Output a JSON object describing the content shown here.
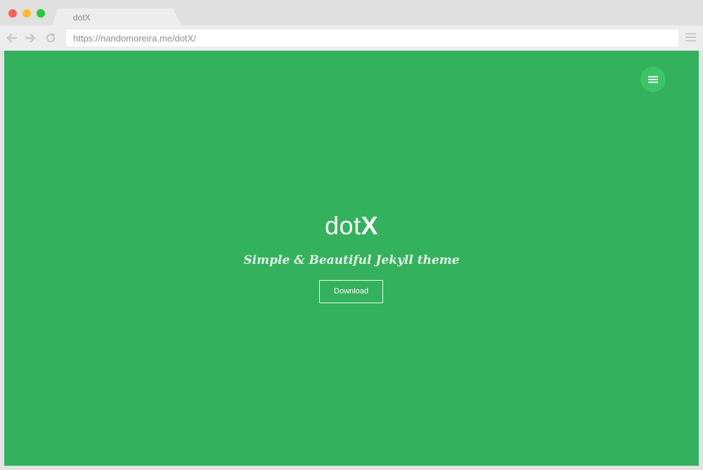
{
  "browser": {
    "tab_title": "dotX",
    "url": "https://nandomoreira.me/dotX/",
    "icons": {
      "back": "arrow-left-icon",
      "forward": "arrow-right-icon",
      "reload": "reload-icon",
      "menu": "hamburger-icon"
    },
    "traffic_colors": [
      "#fe5f57",
      "#febc2e",
      "#28c840"
    ]
  },
  "page": {
    "background_color": "#34b15c",
    "brand": {
      "light": "dot",
      "bold": "X"
    },
    "tagline": "Simple & Beautiful Jekyll theme",
    "download_label": "Download",
    "menu_icon": "hamburger-icon"
  }
}
